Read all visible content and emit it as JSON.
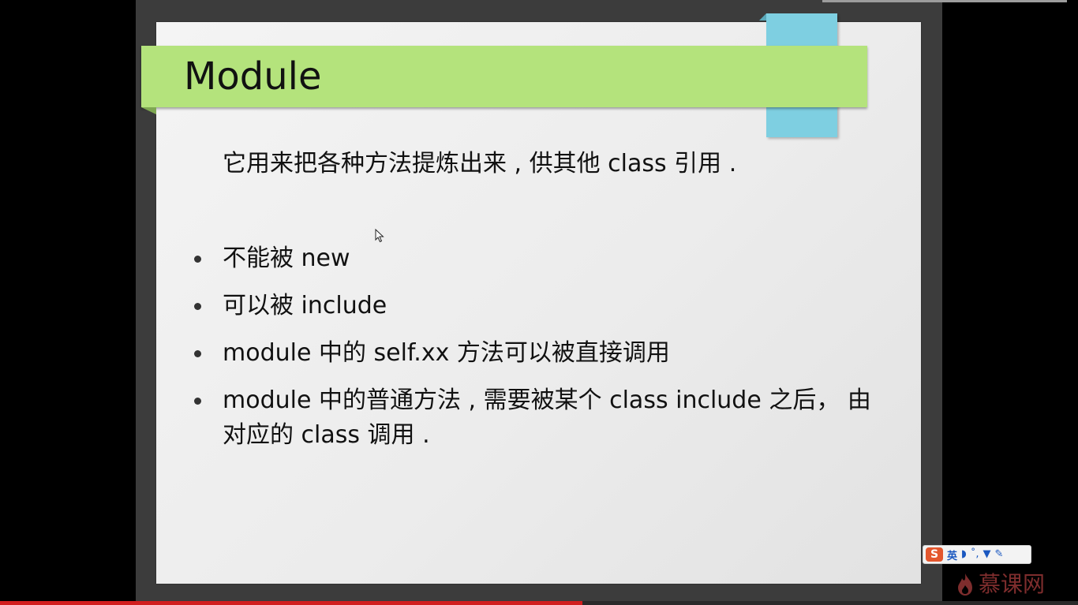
{
  "slide": {
    "title": "Module",
    "intro": "它用来把各种方法提炼出来 , 供其他  class  引用 .",
    "bullets": [
      "不能被 new",
      "可以被 include",
      "module 中的  self.xx 方法可以被直接调用",
      "module 中的普通方法 , 需要被某个 class include 之后， 由对应的 class 调用 ."
    ]
  },
  "ime_toolbar": {
    "logo_letter": "S",
    "language": "英",
    "tools": [
      "moon-icon",
      "punctuation-icon",
      "shirt-icon",
      "wrench-icon"
    ]
  },
  "watermark": {
    "text": "慕课网"
  },
  "video": {
    "progress": 0.54
  },
  "colors": {
    "title_bar": "#b4e37c",
    "accent_blue": "#7ecfe1",
    "progress": "#d21f1f",
    "watermark": "#e55252"
  }
}
